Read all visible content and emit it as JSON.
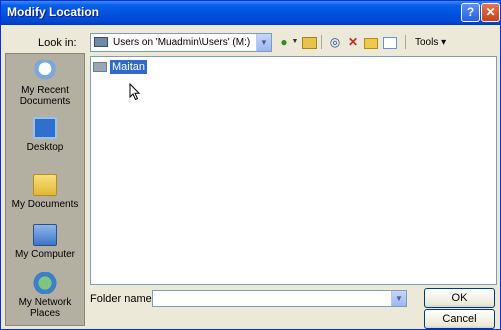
{
  "window": {
    "title": "Modify Location"
  },
  "toolbar": {
    "lookin_label": "Look in:",
    "lookin_value": "Users on 'Muadmin\\Users' (M:)",
    "tools_label": "Tools ▾"
  },
  "places": [
    {
      "label": "My Recent Documents",
      "icon": "recent-documents-icon"
    },
    {
      "label": "Desktop",
      "icon": "desktop-icon"
    },
    {
      "label": "My Documents",
      "icon": "my-documents-icon"
    },
    {
      "label": "My Computer",
      "icon": "my-computer-icon"
    },
    {
      "label": "My Network Places",
      "icon": "network-places-icon"
    }
  ],
  "files": [
    {
      "name": "Maitan",
      "selected": true
    }
  ],
  "footer": {
    "folder_name_label": "Folder name:",
    "folder_name_value": "",
    "ok_label": "OK",
    "cancel_label": "Cancel"
  }
}
